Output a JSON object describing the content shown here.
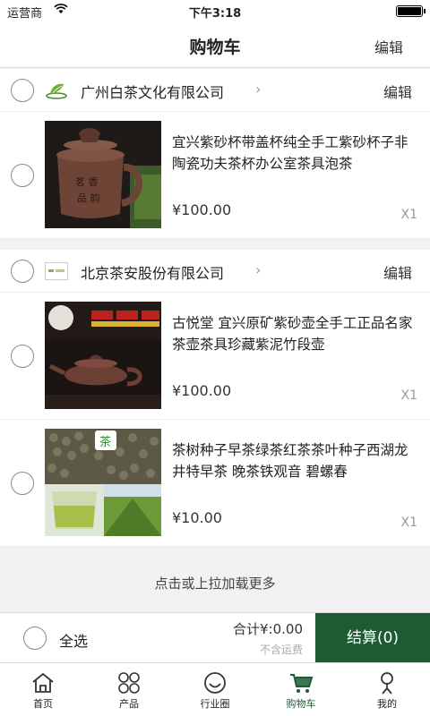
{
  "status": {
    "carrier": "运营商",
    "time": "下午3:18"
  },
  "header": {
    "title": "购物车",
    "edit": "编辑"
  },
  "shops": [
    {
      "name": "广州白茶文化有限公司",
      "edit": "编辑",
      "logo": "tea-leaf-logo",
      "items": [
        {
          "title": "宜兴紫砂杯带盖杯纯全手工紫砂杯子非陶瓷功夫茶杯办公室茶具泡茶",
          "price": "¥100.00",
          "qty": "X1",
          "image": "purple-clay-cup"
        }
      ]
    },
    {
      "name": "北京茶安股份有限公司",
      "edit": "编辑",
      "logo": "company-logo",
      "items": [
        {
          "title": "古悦堂 宜兴原矿紫砂壶全手工正品名家茶壶茶具珍藏紫泥竹段壶",
          "price": "¥100.00",
          "qty": "X1",
          "image": "purple-clay-teapot"
        },
        {
          "title": "茶树种子早茶绿茶红茶茶叶种子西湖龙井特早茶 晚茶铁观音 碧螺春",
          "price": "¥10.00",
          "qty": "X1",
          "image": "tea-seeds"
        }
      ]
    }
  ],
  "load_more": "点击或上拉加载更多",
  "footer": {
    "select_all": "全选",
    "total": "合计¥:0.00",
    "shipping": "不含运费",
    "checkout": "结算(0)"
  },
  "tabs": [
    {
      "label": "首页",
      "icon": "home-icon"
    },
    {
      "label": "产品",
      "icon": "grid-icon"
    },
    {
      "label": "行业圈",
      "icon": "smile-icon"
    },
    {
      "label": "购物车",
      "icon": "cart-icon"
    },
    {
      "label": "我的",
      "icon": "user-icon"
    }
  ],
  "colors": {
    "accent": "#1e5b35",
    "background": "#f2f2f2"
  }
}
